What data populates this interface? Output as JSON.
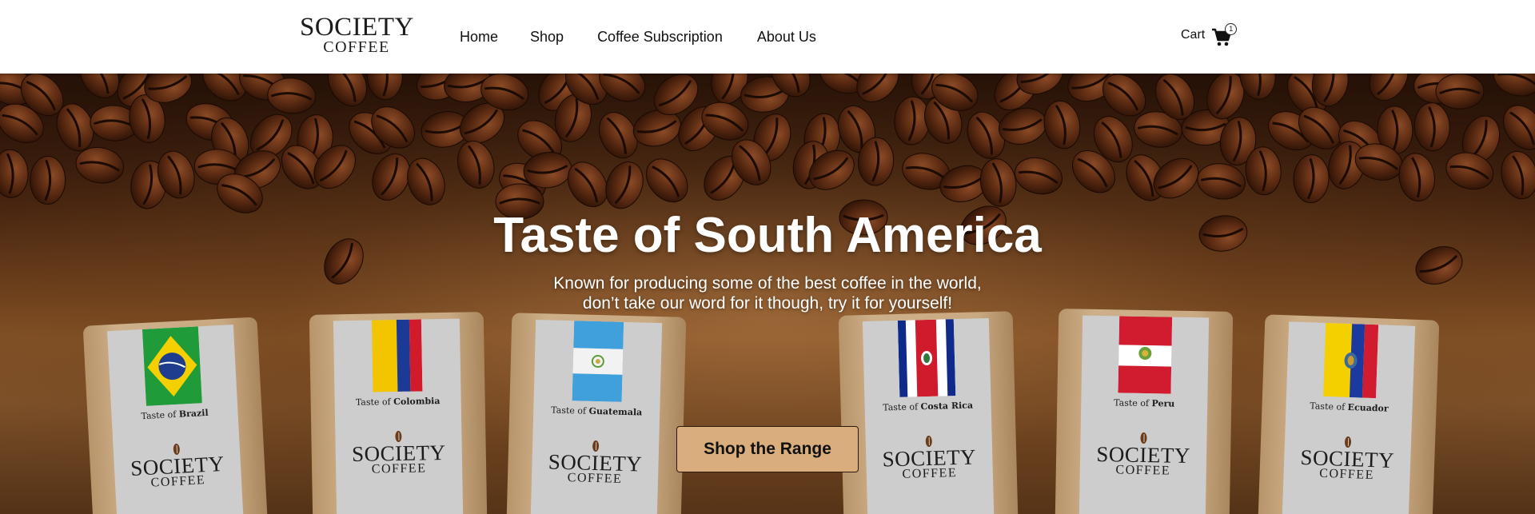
{
  "header": {
    "logo": {
      "line1": "SOCIETY",
      "line2": "COFFEE"
    },
    "nav": [
      {
        "label": "Home"
      },
      {
        "label": "Shop"
      },
      {
        "label": "Coffee Subscription"
      },
      {
        "label": "About Us"
      }
    ],
    "cart": {
      "label": "Cart",
      "count": "1",
      "icon": "shopping-cart-icon"
    }
  },
  "hero": {
    "title": "Taste of South America",
    "subtitle_line1": "Known for producing some of the best coffee in the world,",
    "subtitle_line2": "don’t take our word for it though, try it for yourself!",
    "cta_label": "Shop the Range",
    "bags": [
      {
        "prefix": "Taste of",
        "country": "Brazil",
        "flag_icon": "brazil-flag-icon",
        "logo_line1": "SOCIETY",
        "logo_line2": "COFFEE"
      },
      {
        "prefix": "Taste of",
        "country": "Colombia",
        "flag_icon": "colombia-flag-icon",
        "logo_line1": "SOCIETY",
        "logo_line2": "COFFEE"
      },
      {
        "prefix": "Taste of",
        "country": "Guatemala",
        "flag_icon": "guatemala-flag-icon",
        "logo_line1": "SOCIETY",
        "logo_line2": "COFFEE"
      },
      {
        "prefix": "Taste of",
        "country": "Costa Rica",
        "flag_icon": "costa-rica-flag-icon",
        "logo_line1": "SOCIETY",
        "logo_line2": "COFFEE"
      },
      {
        "prefix": "Taste of",
        "country": "Peru",
        "flag_icon": "peru-flag-icon",
        "logo_line1": "SOCIETY",
        "logo_line2": "COFFEE"
      },
      {
        "prefix": "Taste of",
        "country": "Ecuador",
        "flag_icon": "ecuador-flag-icon",
        "logo_line1": "SOCIETY",
        "logo_line2": "COFFEE"
      }
    ]
  },
  "colors": {
    "cta_background": "#d9ad7c",
    "hero_brown": "#8a5a2e",
    "bean_brown": "#4a220f",
    "bag_label_grey": "#cdcdcd",
    "kraft": "#c9a982"
  }
}
